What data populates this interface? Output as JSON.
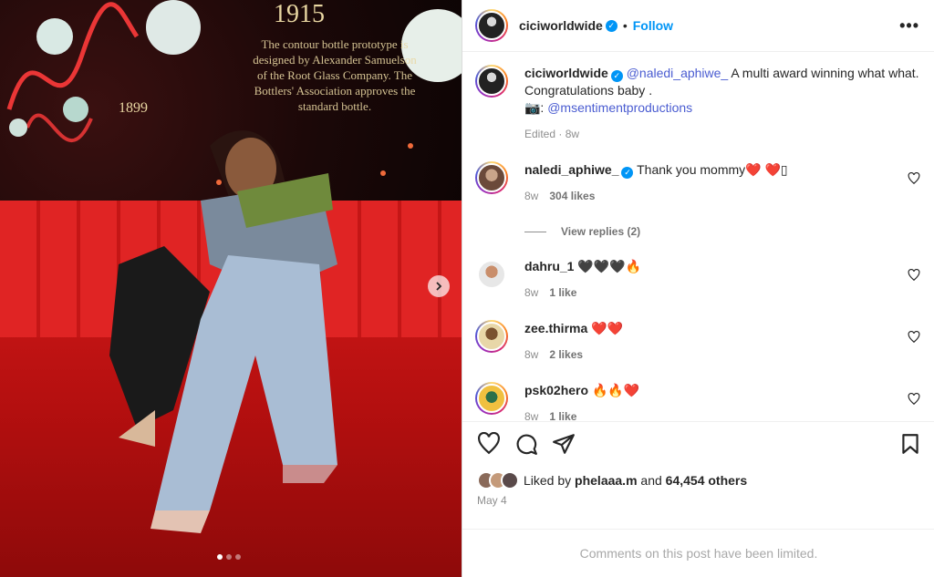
{
  "post": {
    "author": "ciciworldwide",
    "follow_label": "Follow",
    "separator": "•",
    "more_label": "•••"
  },
  "photo": {
    "year_top": "1915",
    "year_side": "1899",
    "plaque_lines": "The contour bottle prototype is designed by Alexander Samuelson of the Root Glass Company. The Bottlers' Association approves the standard bottle.",
    "slide_index": 1,
    "slide_count": 3
  },
  "caption": {
    "username": "ciciworldwide",
    "mention": "@naledi_aphiwe_",
    "text_1": " A multi award winning what what. Congratulations baby .",
    "camera": "📷:",
    "mention_2": "@msentimentproductions",
    "edited": "Edited",
    "age": "8w"
  },
  "comments": [
    {
      "username": "naledi_aphiwe_",
      "text": "Thank you mommy❤️ ❤️▯",
      "age": "8w",
      "likes": "304 likes",
      "verified": true
    },
    {
      "username": "dahru_1",
      "text": "🖤🖤🖤🔥",
      "age": "8w",
      "likes": "1 like"
    },
    {
      "username": "zee.thirma",
      "text": "❤️❤️",
      "age": "8w",
      "likes": "2 likes"
    },
    {
      "username": "psk02hero",
      "text": "🔥🔥❤️",
      "age": "8w",
      "likes": "1 like"
    }
  ],
  "view_replies": "View replies (2)",
  "likes": {
    "prefix": "Liked by",
    "user": "phelaaa.m",
    "and": "and",
    "others": "64,454 others"
  },
  "date": "May 4",
  "limited_notice": "Comments on this post have been limited.",
  "colors": {
    "accent": "#0095f6",
    "link": "#00376b",
    "mention": "#4a5cd1"
  }
}
